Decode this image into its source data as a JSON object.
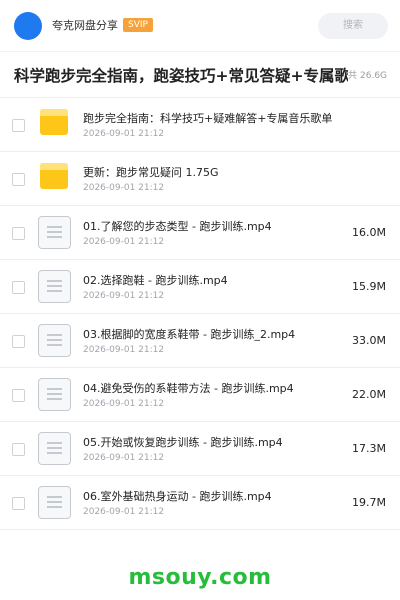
{
  "header": {
    "username": "夸克网盘分享",
    "badge": "SVIP",
    "search_placeholder": "搜索",
    "brand_color": "#1f7af0",
    "badge_color": "#f6a23a"
  },
  "folder_title": {
    "title": "科学跑步完全指南，跑姿技巧+常见答疑+专属歌单",
    "meta_prefix": "共",
    "total_size": "26.6G"
  },
  "files": [
    {
      "icon": "folder-icon",
      "name": "跑步完全指南：科学技巧+疑难解答+专属音乐歌单",
      "date": "2026-09-01 21:12",
      "size": ""
    },
    {
      "icon": "folder-icon",
      "name": "更新：跑步常见疑问 1.75G",
      "date": "2026-09-01 21:12",
      "size": ""
    },
    {
      "icon": "document-icon",
      "name": "01.了解您的步态类型 - 跑步训练.mp4",
      "date": "2026-09-01 21:12",
      "size": "16.0M"
    },
    {
      "icon": "document-icon",
      "name": "02.选择跑鞋 - 跑步训练.mp4",
      "date": "2026-09-01 21:12",
      "size": "15.9M"
    },
    {
      "icon": "document-icon",
      "name": "03.根据脚的宽度系鞋带 - 跑步训练_2.mp4",
      "date": "2026-09-01 21:12",
      "size": "33.0M"
    },
    {
      "icon": "document-icon",
      "name": "04.避免受伤的系鞋带方法 - 跑步训练.mp4",
      "date": "2026-09-01 21:12",
      "size": "22.0M"
    },
    {
      "icon": "document-icon",
      "name": "05.开始或恢复跑步训练 - 跑步训练.mp4",
      "date": "2026-09-01 21:12",
      "size": "17.3M"
    },
    {
      "icon": "document-icon",
      "name": "06.室外基础热身运动 - 跑步训练.mp4",
      "date": "2026-09-01 21:12",
      "size": "19.7M"
    }
  ],
  "watermark": {
    "text": "msouy.com",
    "color": "#26bd3a"
  }
}
